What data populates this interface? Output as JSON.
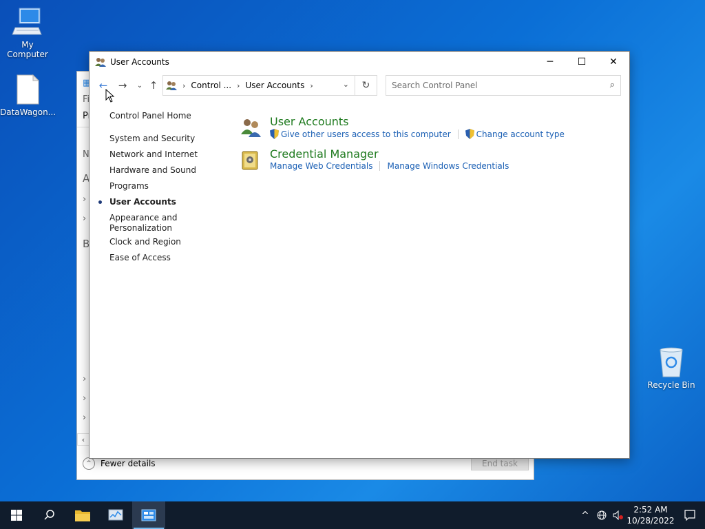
{
  "desktop": {
    "icons": [
      {
        "label": "My Computer"
      },
      {
        "label": "DataWagon..."
      },
      {
        "label": "Recycle Bin"
      }
    ]
  },
  "taskmgr": {
    "fragments": [
      "Fi",
      "Pr",
      "Na",
      "A",
      "B"
    ],
    "fewer_details": "Fewer details",
    "end_task": "End task"
  },
  "window": {
    "title": "User Accounts",
    "address": {
      "crumbs": [
        "Control ...",
        "User Accounts"
      ]
    },
    "search": {
      "placeholder": "Search Control Panel"
    },
    "leftnav": [
      {
        "label": "Control Panel Home"
      },
      {
        "label": "System and Security"
      },
      {
        "label": "Network and Internet"
      },
      {
        "label": "Hardware and Sound"
      },
      {
        "label": "Programs"
      },
      {
        "label": "User Accounts",
        "active": true
      },
      {
        "label": "Appearance and Personalization"
      },
      {
        "label": "Clock and Region"
      },
      {
        "label": "Ease of Access"
      }
    ],
    "categories": [
      {
        "heading": "User Accounts",
        "links": [
          "Give other users access to this computer",
          "Change account type"
        ]
      },
      {
        "heading": "Credential Manager",
        "links": [
          "Manage Web Credentials",
          "Manage Windows Credentials"
        ]
      }
    ]
  },
  "taskbar": {
    "time": "2:52 AM",
    "date": "10/28/2022"
  },
  "colors": {
    "link": "#1a5fb4",
    "heading": "#1e7a1e",
    "taskbar": "#101c2c"
  }
}
